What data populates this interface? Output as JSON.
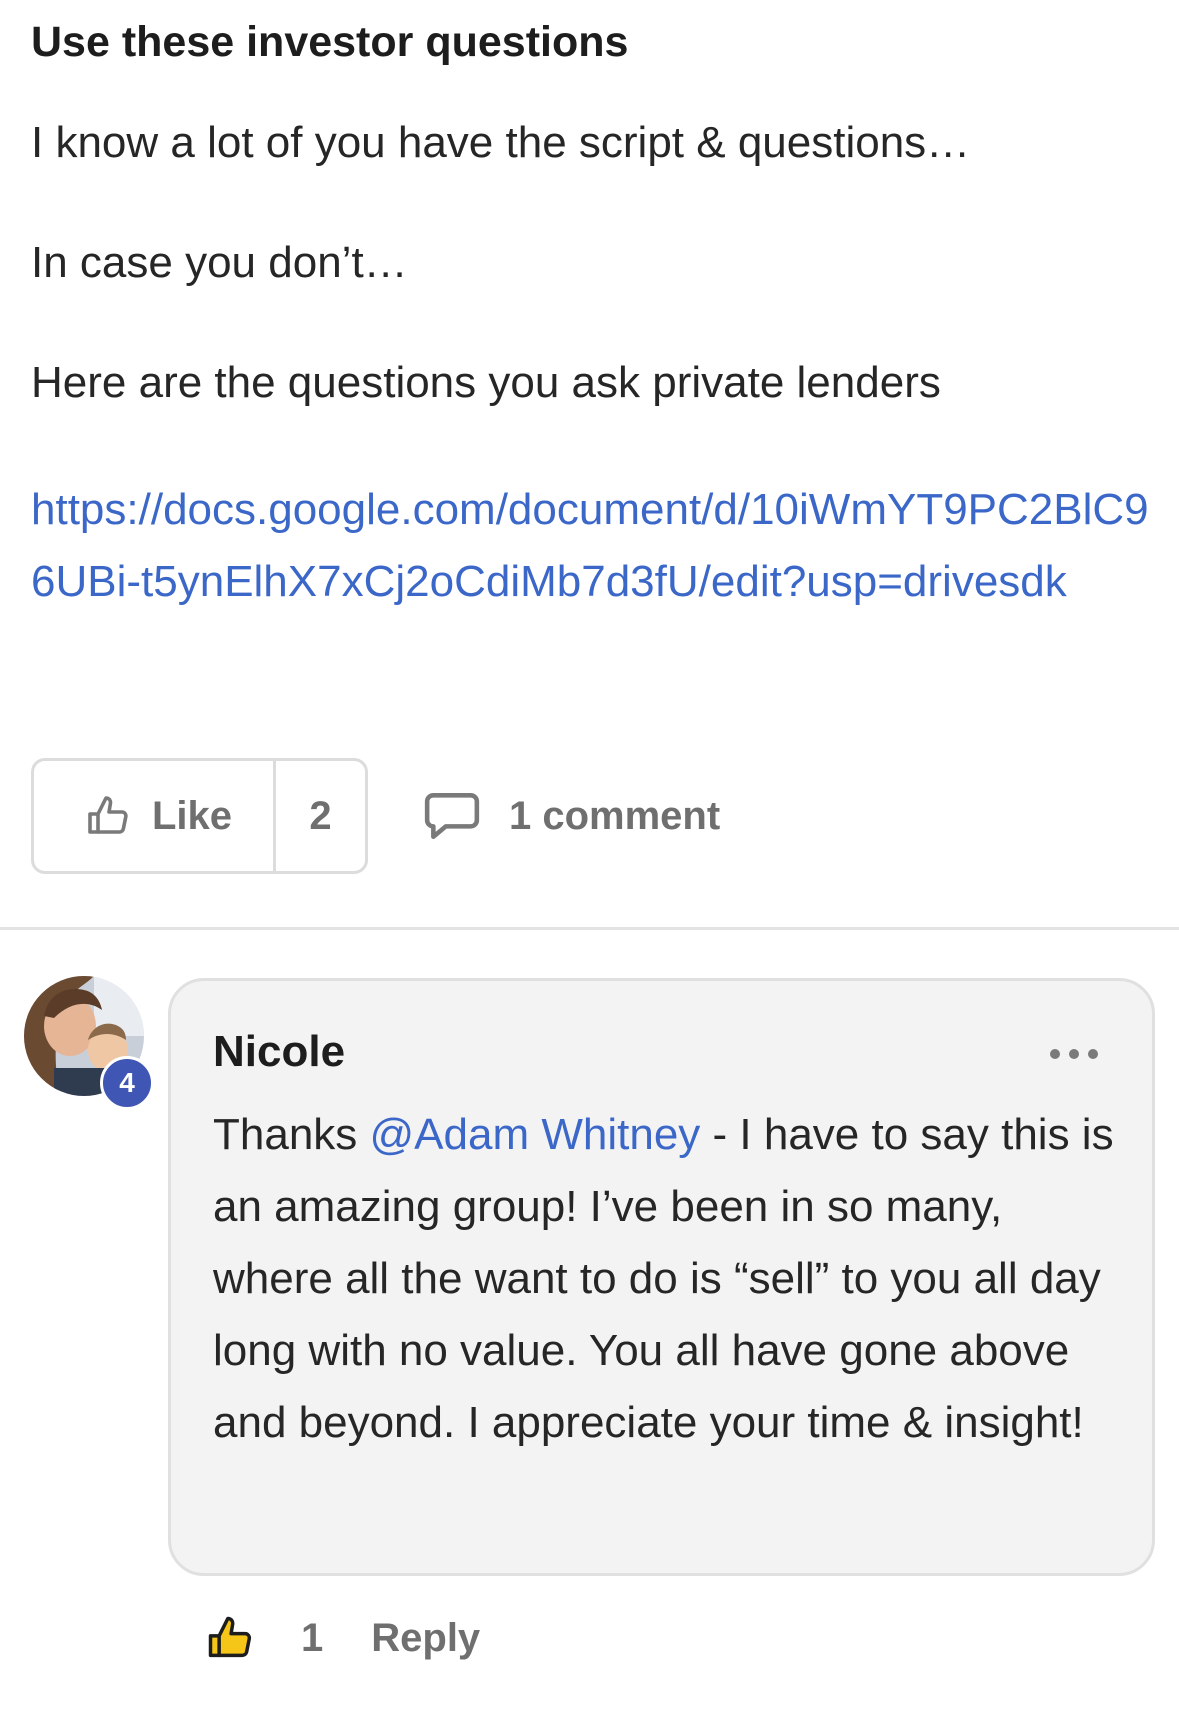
{
  "post": {
    "title": "Use these investor questions",
    "paragraphs": [
      "I know a lot of you have the script & questions…",
      "In case you don’t…",
      "Here are the questions you ask private lenders"
    ],
    "link": "https://docs.google.com/document/d/10iWmYT9PC2BlC96UBi-t5ynElhX7xCj2oCdiMb7d3fU/edit?usp=drivesdk"
  },
  "actions": {
    "like_label": "Like",
    "like_count": "2",
    "comment_label": "1 comment",
    "icons": {
      "like": "thumbs-up-outline-icon",
      "comment": "speech-bubble-icon"
    }
  },
  "comment": {
    "author": "Nicole",
    "level": "4",
    "text_before": "Thanks ",
    "mention": "@Adam Whitney",
    "text_after": " - I have to say this is an amazing group! I’ve been in so many, where all the want to do is “sell” to you all day long with no value. You all have gone above and beyond. I appreciate your time & insight!",
    "like_count": "1",
    "reply_label": "Reply",
    "icons": {
      "more": "more-options-icon",
      "like": "thumbs-up-filled-icon"
    }
  },
  "colors": {
    "link": "#3b67c8",
    "badge": "#3f56b5",
    "thumb_filled": "#f5c518",
    "muted_text": "#6f6f6f"
  }
}
